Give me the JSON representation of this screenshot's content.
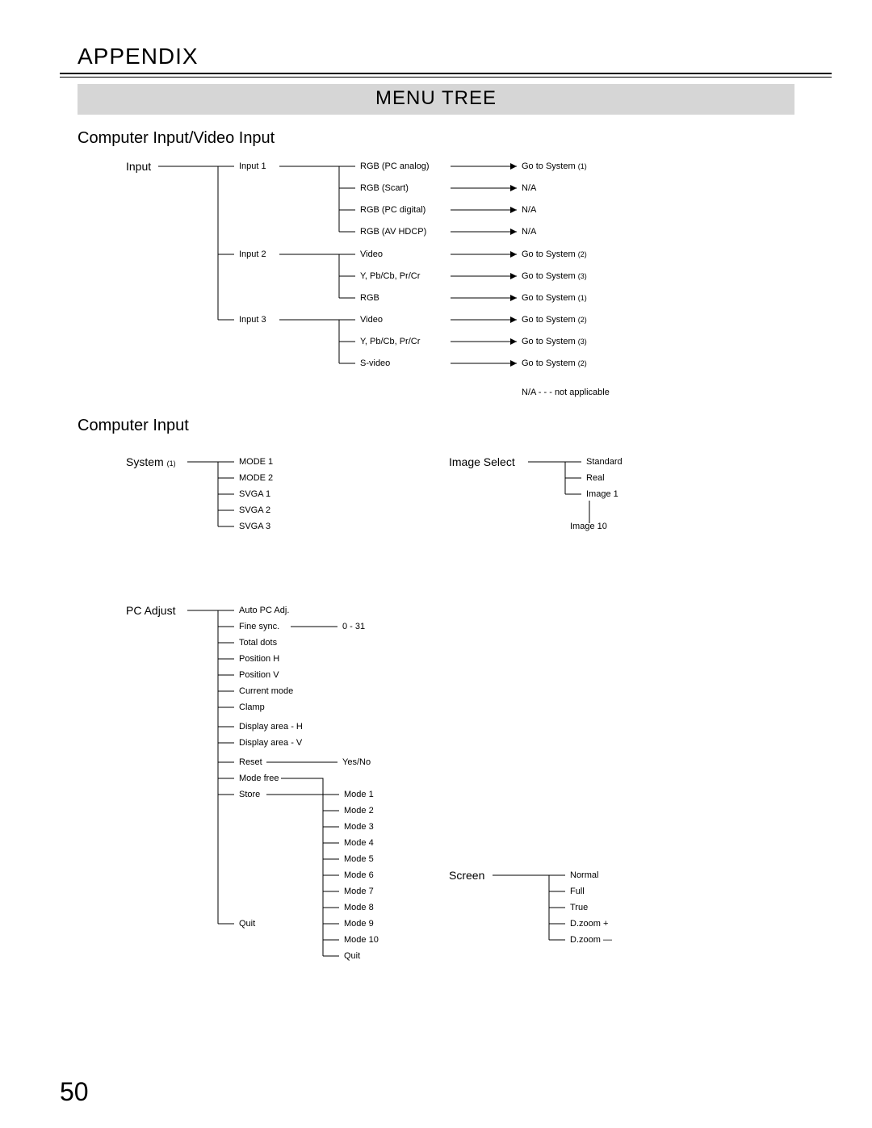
{
  "header": "APPENDIX",
  "title": "MENU TREE",
  "section1": "Computer Input/Video Input",
  "section2": "Computer Input",
  "page_num": "50",
  "na_note": "N/A - - - not applicable",
  "input": {
    "root": "Input",
    "b1": "Input 1",
    "b2": "Input 2",
    "b3": "Input 3",
    "i1": {
      "a": "RGB (PC analog)",
      "b": "RGB (Scart)",
      "c": "RGB (PC digital)",
      "d": "RGB (AV HDCP)"
    },
    "i2": {
      "a": "Video",
      "b": "Y, Pb/Cb, Pr/Cr",
      "c": "RGB"
    },
    "i3": {
      "a": "Video",
      "b": "Y, Pb/Cb, Pr/Cr",
      "c": "S-video"
    },
    "r1": {
      "a": "Go to System",
      "as": "(1)",
      "b": "N/A",
      "c": "N/A",
      "d": "N/A"
    },
    "r2": {
      "a": "Go to System",
      "as": "(2)",
      "b": "Go to System",
      "bs": "(3)",
      "c": "Go to System",
      "cs": "(1)"
    },
    "r3": {
      "a": "Go to System",
      "as": "(2)",
      "b": "Go to System",
      "bs": "(3)",
      "c": "Go to System",
      "cs": "(2)"
    }
  },
  "system": {
    "root": "System",
    "root_s": "(1)",
    "a": "MODE 1",
    "b": "MODE 2",
    "c": "SVGA 1",
    "d": "SVGA 2",
    "e": "SVGA 3"
  },
  "imgsel": {
    "root": "Image Select",
    "a": "Standard",
    "b": "Real",
    "c": "Image 1",
    "d": "Image 10"
  },
  "pcadj": {
    "root": "PC Adjust",
    "a": "Auto PC Adj.",
    "b": "Fine sync.",
    "bval": "0 - 31",
    "c": "Total dots",
    "d": "Position H",
    "e": "Position V",
    "f": "Current mode",
    "g": "Clamp",
    "h": "Display area - H",
    "i": "Display area - V",
    "j": "Reset",
    "jval": "Yes/No",
    "k": "Mode free",
    "l": "Store",
    "q": "Quit",
    "m1": "Mode 1",
    "m2": "Mode 2",
    "m3": "Mode 3",
    "m4": "Mode 4",
    "m5": "Mode 5",
    "m6": "Mode 6",
    "m7": "Mode 7",
    "m8": "Mode 8",
    "m9": "Mode 9",
    "m10": "Mode 10",
    "mq": "Quit"
  },
  "screen": {
    "root": "Screen",
    "a": "Normal",
    "b": "Full",
    "c": "True",
    "d": "D.zoom +",
    "e": "D.zoom —"
  }
}
